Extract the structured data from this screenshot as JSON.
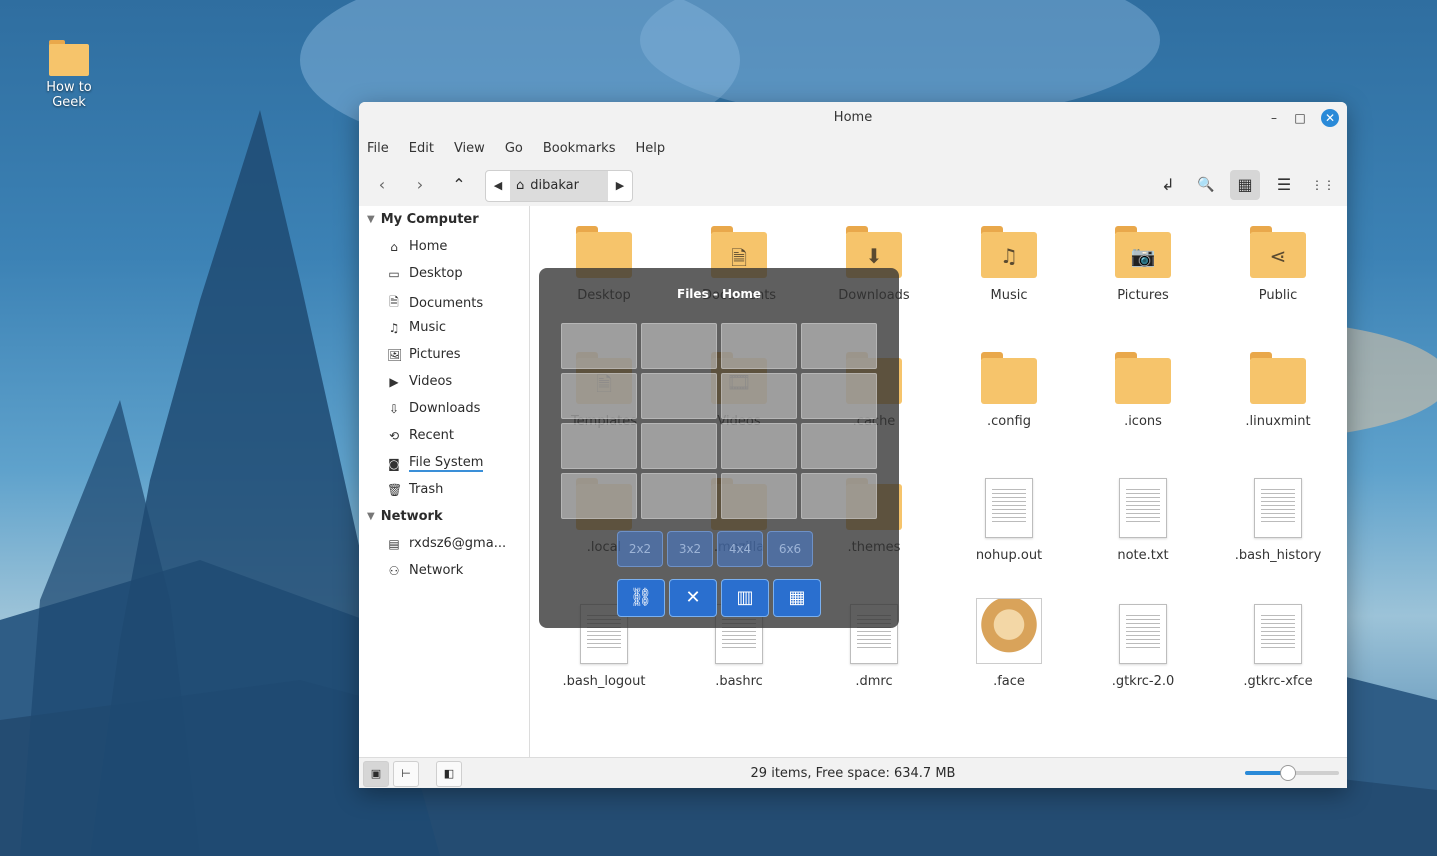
{
  "desktop": {
    "icon_label": "How to Geek"
  },
  "window": {
    "title": "Home",
    "controls": {
      "minimize": "–",
      "maximize": "□",
      "close": "✕"
    }
  },
  "menubar": [
    "File",
    "Edit",
    "View",
    "Go",
    "Bookmarks",
    "Help"
  ],
  "toolbar": {
    "back": "‹",
    "forward": "›",
    "up": "⌃",
    "crumb_left": "◀",
    "crumb_right": "▶",
    "path": "dibakar",
    "toggle_location_icon": "↲",
    "search_icon": "🔍",
    "icon_view_icon": "▦",
    "list_view_icon": "☰",
    "compact_view_icon": "⋮⋮"
  },
  "sidebar": {
    "my_computer": "My Computer",
    "items": [
      {
        "label": "Home",
        "icon": "⌂"
      },
      {
        "label": "Desktop",
        "icon": "▭"
      },
      {
        "label": "Documents",
        "icon": "🗎"
      },
      {
        "label": "Music",
        "icon": "♫"
      },
      {
        "label": "Pictures",
        "icon": "🖼"
      },
      {
        "label": "Videos",
        "icon": "▶"
      },
      {
        "label": "Downloads",
        "icon": "⇩"
      },
      {
        "label": "Recent",
        "icon": "⟲"
      },
      {
        "label": "File System",
        "icon": "◙"
      },
      {
        "label": "Trash",
        "icon": "🗑"
      }
    ],
    "network": "Network",
    "network_items": [
      {
        "label": "rxdsz6@gma...",
        "icon": "▤"
      },
      {
        "label": "Network",
        "icon": "⚇"
      }
    ]
  },
  "files": [
    {
      "name": "Desktop",
      "type": "folder",
      "emblem": ""
    },
    {
      "name": "Documents",
      "type": "folder",
      "emblem": "🗎"
    },
    {
      "name": "Downloads",
      "type": "folder",
      "emblem": "⬇"
    },
    {
      "name": "Music",
      "type": "folder",
      "emblem": "♫"
    },
    {
      "name": "Pictures",
      "type": "folder",
      "emblem": "📷"
    },
    {
      "name": "Public",
      "type": "folder",
      "emblem": "⋖"
    },
    {
      "name": "Templates",
      "type": "folder",
      "emblem": "🗎"
    },
    {
      "name": "Videos",
      "type": "folder",
      "emblem": "🎞"
    },
    {
      "name": ".cache",
      "type": "folder",
      "emblem": ""
    },
    {
      "name": ".config",
      "type": "folder",
      "emblem": ""
    },
    {
      "name": ".icons",
      "type": "folder",
      "emblem": ""
    },
    {
      "name": ".linuxmint",
      "type": "folder",
      "emblem": ""
    },
    {
      "name": ".local",
      "type": "folder",
      "emblem": ""
    },
    {
      "name": ".mozilla",
      "type": "folder",
      "emblem": ""
    },
    {
      "name": ".themes",
      "type": "folder",
      "emblem": ""
    },
    {
      "name": "nohup.out",
      "type": "doc",
      "emblem": ""
    },
    {
      "name": "note.txt",
      "type": "doc",
      "emblem": ""
    },
    {
      "name": ".bash_history",
      "type": "doc",
      "emblem": ""
    },
    {
      "name": ".bash_logout",
      "type": "doc",
      "emblem": ""
    },
    {
      "name": ".bashrc",
      "type": "doc",
      "emblem": ""
    },
    {
      "name": ".dmrc",
      "type": "doc",
      "emblem": ""
    },
    {
      "name": ".face",
      "type": "image",
      "emblem": ""
    },
    {
      "name": ".gtkrc-2.0",
      "type": "doc",
      "emblem": ""
    },
    {
      "name": ".gtkrc-xfce",
      "type": "doc",
      "emblem": ""
    }
  ],
  "status": {
    "text": "29 items, Free space: 634.7 MB",
    "zoom_level": 0.45,
    "places_icon": "▣",
    "tree_icon": "⊢",
    "hide_sidebar_icon": "◧"
  },
  "tiling": {
    "title": "Files - Home",
    "presets": [
      "2x2",
      "3x2",
      "4x4",
      "6x6"
    ],
    "actions": [
      {
        "icon": "⛓",
        "name": "link-icon"
      },
      {
        "icon": "✕",
        "name": "close-tile-icon"
      },
      {
        "icon": "▥",
        "name": "layout-a-icon"
      },
      {
        "icon": "▦",
        "name": "layout-b-icon"
      }
    ]
  }
}
